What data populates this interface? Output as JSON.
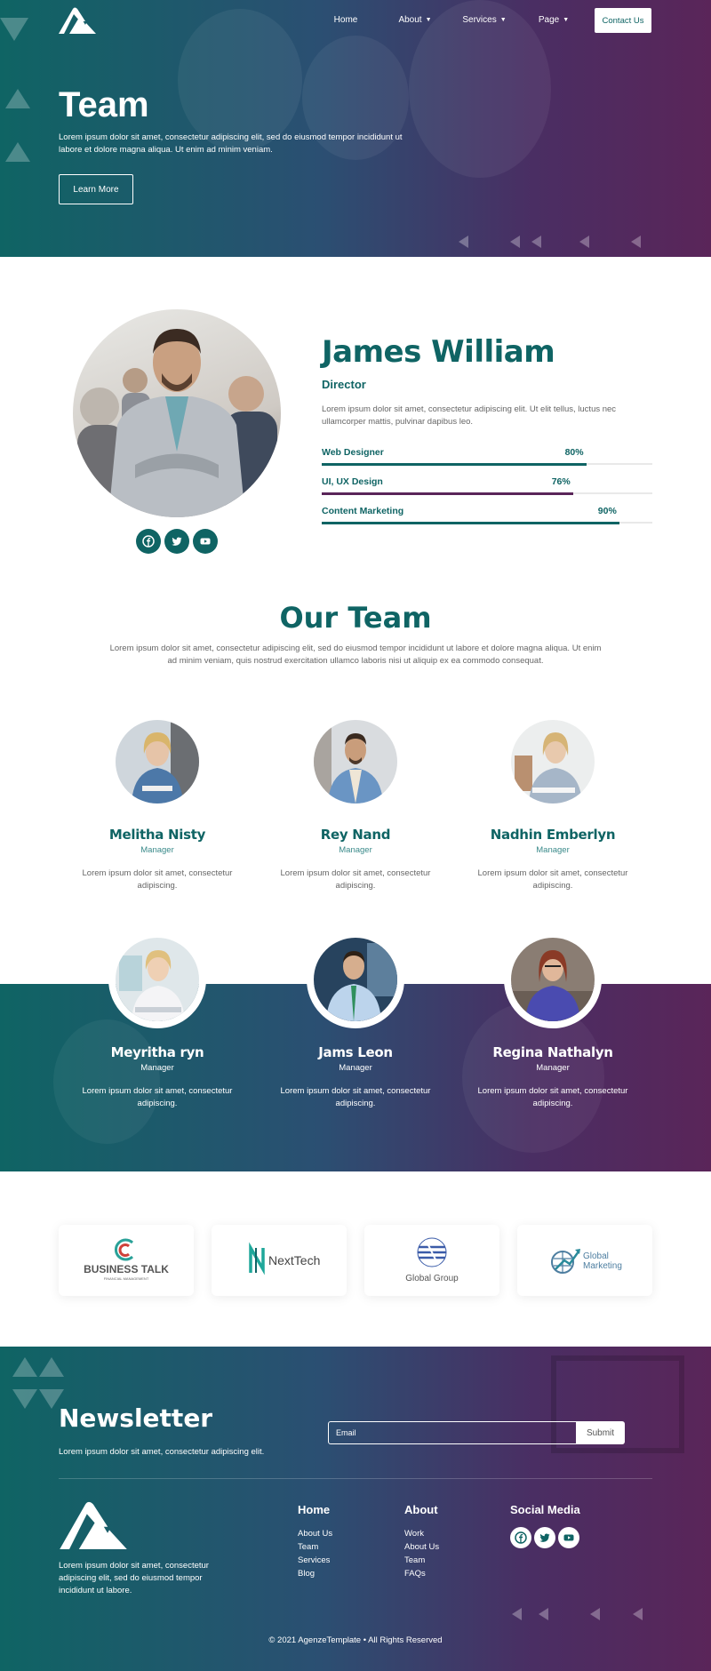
{
  "colors": {
    "teal": "#0f6464",
    "purple": "#5a2559",
    "skill_purple": "#5a2559"
  },
  "nav": {
    "items": [
      {
        "label": "Home",
        "has_dropdown": false
      },
      {
        "label": "About",
        "has_dropdown": true
      },
      {
        "label": "Services",
        "has_dropdown": true
      },
      {
        "label": "Page",
        "has_dropdown": true
      }
    ],
    "contact_label": "Contact Us"
  },
  "hero": {
    "title": "Team",
    "text": "Lorem ipsum dolor sit amet, consectetur adipiscing elit, sed do eiusmod tempor incididunt ut labore et dolore magna aliqua. Ut enim ad minim veniam.",
    "button_label": "Learn More"
  },
  "profile": {
    "name": "James William",
    "role": "Director",
    "description": "Lorem ipsum dolor sit amet, consectetur adipiscing elit. Ut elit tellus, luctus nec ullamcorper mattis, pulvinar dapibus leo.",
    "social_icons": [
      "facebook-icon",
      "twitter-icon",
      "youtube-icon"
    ],
    "skills": [
      {
        "label": "Web Designer",
        "value_text": "80%",
        "percent": 80,
        "color": "#0f6464"
      },
      {
        "label": "UI, UX Design",
        "value_text": "76%",
        "percent": 76,
        "color": "#5a2559"
      },
      {
        "label": "Content Marketing",
        "value_text": "90%",
        "percent": 90,
        "color": "#0f6464"
      }
    ]
  },
  "team": {
    "title": "Our Team",
    "text": "Lorem ipsum dolor sit amet, consectetur adipiscing elit, sed do eiusmod tempor incididunt ut labore et dolore magna aliqua. Ut enim ad minim veniam, quis nostrud exercitation ullamco laboris nisi ut aliquip ex ea commodo consequat.",
    "members": [
      {
        "name": "Melitha Nisty",
        "role": "Manager",
        "desc": "Lorem ipsum dolor sit amet, consectetur adipiscing."
      },
      {
        "name": "Rey Nand",
        "role": "Manager",
        "desc": "Lorem ipsum dolor sit amet, consectetur adipiscing."
      },
      {
        "name": "Nadhin Emberlyn",
        "role": "Manager",
        "desc": "Lorem ipsum dolor sit amet, consectetur adipiscing."
      },
      {
        "name": "Meyritha ryn",
        "role": "Manager",
        "desc": "Lorem ipsum dolor sit amet, consectetur adipiscing."
      },
      {
        "name": "Jams Leon",
        "role": "Manager",
        "desc": "Lorem ipsum dolor sit amet, consectetur adipiscing."
      },
      {
        "name": "Regina Nathalyn",
        "role": "Manager",
        "desc": "Lorem ipsum dolor sit amet, consectetur adipiscing."
      }
    ]
  },
  "clients": [
    {
      "name": "BUSINESS TALK",
      "tagline": "FINANCIAL MANAGEMENT"
    },
    {
      "name": "NextTech",
      "tagline": ""
    },
    {
      "name": "Global Group",
      "tagline": ""
    },
    {
      "name": "Global Marketing",
      "tagline": ""
    }
  ],
  "newsletter": {
    "title": "Newsletter",
    "text": "Lorem ipsum dolor sit amet, consectetur adipiscing elit.",
    "email_placeholder": "Email",
    "submit_label": "Submit"
  },
  "footer": {
    "about_text": "Lorem ipsum dolor sit amet, consectetur adipiscing elit, sed do eiusmod tempor incididunt ut labore.",
    "home": {
      "heading": "Home",
      "links": [
        "About Us",
        "Team",
        "Services",
        "Blog"
      ]
    },
    "about": {
      "heading": "About",
      "links": [
        "Work",
        "About Us",
        "Team",
        "FAQs"
      ]
    },
    "social": {
      "heading": "Social Media",
      "icons": [
        "facebook-icon",
        "twitter-icon",
        "youtube-icon"
      ]
    },
    "copyright": "© 2021 AgenzeTemplate • All Rights Reserved"
  }
}
